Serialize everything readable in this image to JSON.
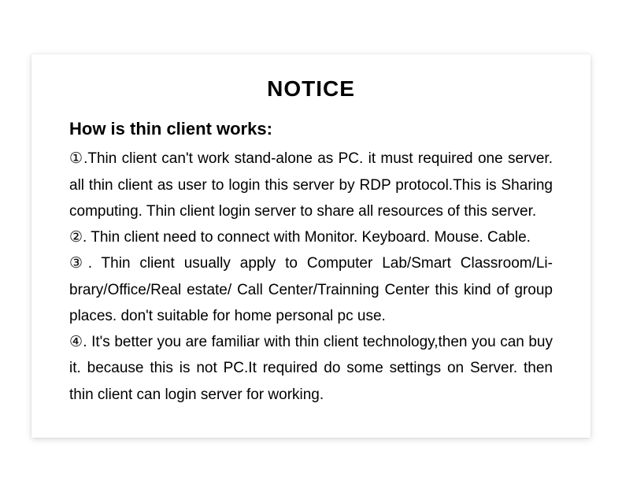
{
  "title": "NOTICE",
  "subtitle": "How is thin client works:",
  "items": [
    {
      "marker": "①",
      "text": ".Thin client can't work stand-alone as PC. it must required one server. all thin client as user to login this server by RDP protocol.This is Sharing computing. Thin client login server to share all resources of this server."
    },
    {
      "marker": "②",
      "text": ". Thin client need to connect with Monitor. Keyboard. Mouse. Cable."
    },
    {
      "marker": "③",
      "text": ". Thin client usually apply to Computer Lab/Smart Classroom/Li­brary/Office/Real estate/ Call Center/Trainning Center this kind of group places. don't suitable for home personal pc use."
    },
    {
      "marker": "④",
      "text": ". It's better you are familiar with thin client technology,then you can buy it. because this is not PC.It required do some settings on Server. then thin client can login server for working."
    }
  ]
}
